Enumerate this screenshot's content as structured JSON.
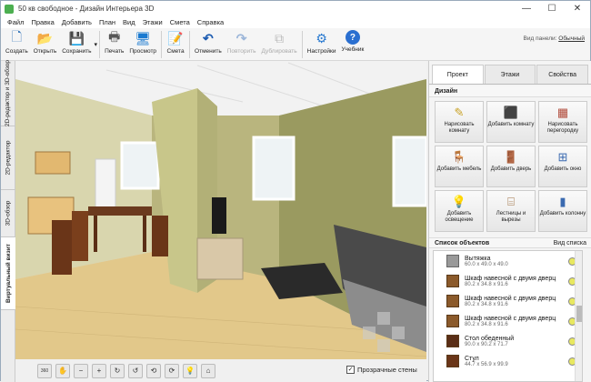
{
  "window": {
    "title": "50 кв свободное - Дизайн Интерьера 3D",
    "minimize": "—",
    "maximize": "☐",
    "close": "✕"
  },
  "menu": [
    "Файл",
    "Правка",
    "Добавить",
    "План",
    "Вид",
    "Этажи",
    "Смета",
    "Справка"
  ],
  "toolbar": {
    "buttons": [
      {
        "label": "Создать",
        "icon": "new-document-icon",
        "glyph": "🗋"
      },
      {
        "label": "Открыть",
        "icon": "folder-open-icon",
        "glyph": "📂"
      },
      {
        "label": "Сохранить",
        "icon": "save-icon",
        "glyph": "💾"
      },
      {
        "label": "Печать",
        "icon": "printer-icon",
        "glyph": "🖶"
      },
      {
        "label": "Просмотр",
        "icon": "monitor-icon",
        "glyph": "🖥"
      },
      {
        "label": "Смета",
        "icon": "estimate-icon",
        "glyph": "📝"
      },
      {
        "label": "Отменить",
        "icon": "undo-icon",
        "glyph": "↶"
      },
      {
        "label": "Повторить",
        "icon": "redo-icon",
        "glyph": "↷"
      },
      {
        "label": "Дублировать",
        "icon": "duplicate-icon",
        "glyph": "⧉"
      },
      {
        "label": "Настройки",
        "icon": "gear-icon",
        "glyph": "⚙"
      },
      {
        "label": "Учебник",
        "icon": "help-icon",
        "glyph": "?"
      }
    ],
    "save_dropdown": "▾",
    "view_panel_label": "Вид панели:",
    "view_panel_value": "Обычный"
  },
  "vtabs": [
    "2D-редактор и 3D-обзор",
    "2D-редактор",
    "3D-обзор",
    "Виртуальный визит"
  ],
  "bottombar": {
    "buttons": [
      "360",
      "✋",
      "−",
      "+",
      "↻",
      "↺",
      "⟲",
      "⟳",
      "💡",
      "⌂"
    ],
    "transparent_walls_label": "Прозрачные стены",
    "transparent_walls_checked": "✓"
  },
  "right_panel": {
    "tabs": [
      "Проект",
      "Этажи",
      "Свойства"
    ],
    "design_header": "Дизайн",
    "design_buttons": [
      {
        "label": "Нарисовать комнату",
        "icon": "draw-room-icon",
        "glyph": "✎",
        "color": "#c9a227"
      },
      {
        "label": "Добавить комнату",
        "icon": "add-room-icon",
        "glyph": "⬛",
        "color": "#c9b400"
      },
      {
        "label": "Нарисовать перегородку",
        "icon": "draw-wall-icon",
        "glyph": "▦",
        "color": "#b04a3a"
      },
      {
        "label": "Добавить мебель",
        "icon": "add-furniture-icon",
        "glyph": "🪑",
        "color": "#4a7ab0"
      },
      {
        "label": "Добавить дверь",
        "icon": "add-door-icon",
        "glyph": "🚪",
        "color": "#b0702a"
      },
      {
        "label": "Добавить окно",
        "icon": "add-window-icon",
        "glyph": "⊞",
        "color": "#3a6ab0"
      },
      {
        "label": "Добавить освещение",
        "icon": "add-light-icon",
        "glyph": "💡",
        "color": "#e0b000"
      },
      {
        "label": "Лестницы и вырезы",
        "icon": "stairs-icon",
        "glyph": "⌸",
        "color": "#9a6a3a"
      },
      {
        "label": "Добавить колонну",
        "icon": "add-column-icon",
        "glyph": "▮",
        "color": "#3a6ab0"
      }
    ],
    "objects_header": "Список объектов",
    "list_view_label": "Вид списка",
    "objects": [
      {
        "name": "Вытяжка",
        "dims": "60.0 x 49.0 x 49.0"
      },
      {
        "name": "Шкаф навесной с двумя дверц",
        "dims": "80.2 x 34.8 x 91.6"
      },
      {
        "name": "Шкаф навесной с двумя дверц",
        "dims": "80.2 x 34.8 x 91.6"
      },
      {
        "name": "Шкаф навесной с двумя дверц",
        "dims": "80.2 x 34.8 x 91.6"
      },
      {
        "name": "Стол обеденный",
        "dims": "90.0 x 90.2 x 71.7"
      },
      {
        "name": "Стул",
        "dims": "44.7 x 56.9 x 99.9"
      }
    ]
  }
}
